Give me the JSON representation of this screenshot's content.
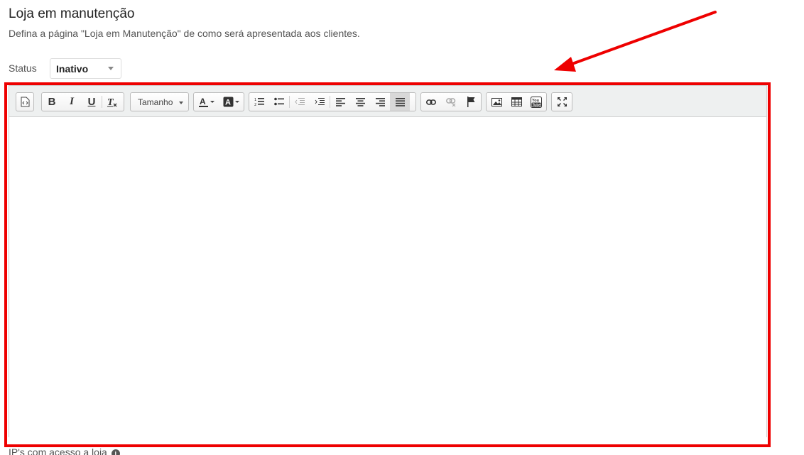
{
  "header": {
    "title": "Loja em manutenção",
    "subtitle": "Defina a página \"Loja em Manutenção\" de como será apresentada aos clientes."
  },
  "status": {
    "label": "Status",
    "selected": "Inativo"
  },
  "editor": {
    "toolbar": {
      "size_combo_label": "Tamanho"
    },
    "content": ""
  },
  "ips": {
    "label": "IP's com acesso a loja"
  },
  "annotation": {
    "color": "#ee0000"
  },
  "toolbar_icons": [
    "source-icon",
    "bold-icon",
    "italic-icon",
    "underline-icon",
    "remove-format-icon",
    "text-color-icon",
    "background-color-icon",
    "numbered-list-icon",
    "bulleted-list-icon",
    "outdent-icon",
    "indent-icon",
    "align-left-icon",
    "align-center-icon",
    "align-right-icon",
    "align-justify-icon",
    "link-icon",
    "unlink-icon",
    "anchor-flag-icon",
    "image-icon",
    "table-icon",
    "youtube-icon",
    "maximize-icon"
  ]
}
